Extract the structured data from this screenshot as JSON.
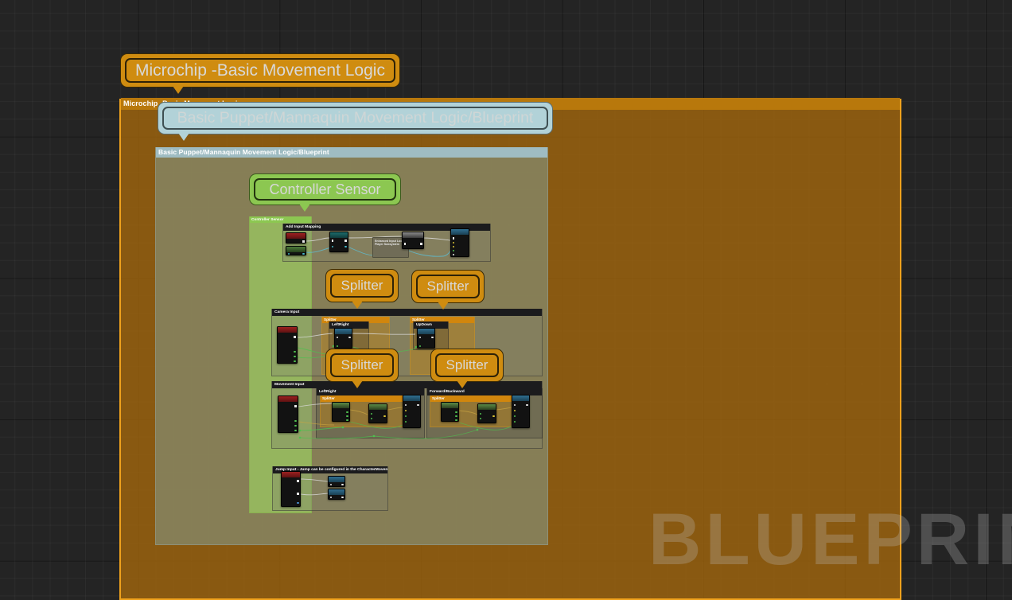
{
  "app": {
    "watermark": "BLUEPRINT",
    "canvas_background": "#242424",
    "grid_minor_color": "rgba(255,255,255,0.035)",
    "grid_major_color": "rgba(0,0,0,0.55)"
  },
  "bubbles": [
    {
      "id": "microchip",
      "label": "Microchip    -Basic Movement Logic",
      "color": "#cf8c10"
    },
    {
      "id": "basicpuppet",
      "label": "Basic Puppet/Mannaquin Movement Logic/Blueprint",
      "color": "#b2d2d8"
    },
    {
      "id": "controller",
      "label": "Controller Sensor",
      "color": "#8cc751"
    },
    {
      "id": "splitter-cam-1",
      "label": "Splitter",
      "color": "#cf8c10"
    },
    {
      "id": "splitter-cam-2",
      "label": "Splitter",
      "color": "#cf8c10"
    },
    {
      "id": "splitter-move-1",
      "label": "Splitter",
      "color": "#cf8c10"
    },
    {
      "id": "splitter-move-2",
      "label": "Splitter",
      "color": "#cf8c10"
    }
  ],
  "comments": {
    "microchip": {
      "title": "Microchip   -Basic Movement Logic",
      "title_bar_color": "#b8780c",
      "border_color": "#f0a21c",
      "fill_color": "rgba(163,103,12,0.80)"
    },
    "basic_puppet": {
      "title": "Basic Puppet/Mannaquin Movement Logic/Blueprint",
      "title_bar_color": "#9fbcc2",
      "fill_color": "rgba(134,133,98,0.86)"
    },
    "controller_sensor": {
      "title": "Controller Sensor",
      "title_bar_color": "#8cc751",
      "fill_color": "rgba(151,189,96,0.88)"
    }
  },
  "sections": [
    {
      "id": "add-input-mapping",
      "title": "Add Input Mapping"
    },
    {
      "id": "camera-input",
      "title": "Camera Input"
    },
    {
      "id": "movement-input",
      "title": "Movement Input"
    },
    {
      "id": "jump-input",
      "title": "Jump Input -  Jump can be configured in the CharacterMovementComponent"
    }
  ],
  "subsections": [
    {
      "id": "cam-leftright",
      "title": "LeftRight",
      "parent": "camera-input"
    },
    {
      "id": "cam-updown",
      "title": "UpDown",
      "parent": "camera-input"
    },
    {
      "id": "move-leftright",
      "title": "LeftRight",
      "parent": "movement-input"
    },
    {
      "id": "move-forward",
      "title": "Forward/Backward",
      "parent": "movement-input"
    }
  ],
  "splitter_groups": [
    {
      "id": "cam-split-1",
      "title": "Splitter"
    },
    {
      "id": "cam-split-2",
      "title": "Splitter"
    },
    {
      "id": "move-split-1",
      "title": "Splitter"
    },
    {
      "id": "move-split-2",
      "title": "Splitter"
    }
  ],
  "node_labels": {
    "subsystem": "Enhanced Input Local Player Subsystem"
  },
  "palette": {
    "node_body": "#121212",
    "header_red": "#9c2020",
    "header_green": "#4d7a3a",
    "header_blue": "#2f6f92",
    "header_teal": "#1d6b6b",
    "header_gray": "#8a8a8a",
    "wire_exec": "#dcdcdc",
    "wire_cyan": "#5fb9cb",
    "wire_green": "#4fbf4f",
    "wire_orange": "#c9a441"
  }
}
